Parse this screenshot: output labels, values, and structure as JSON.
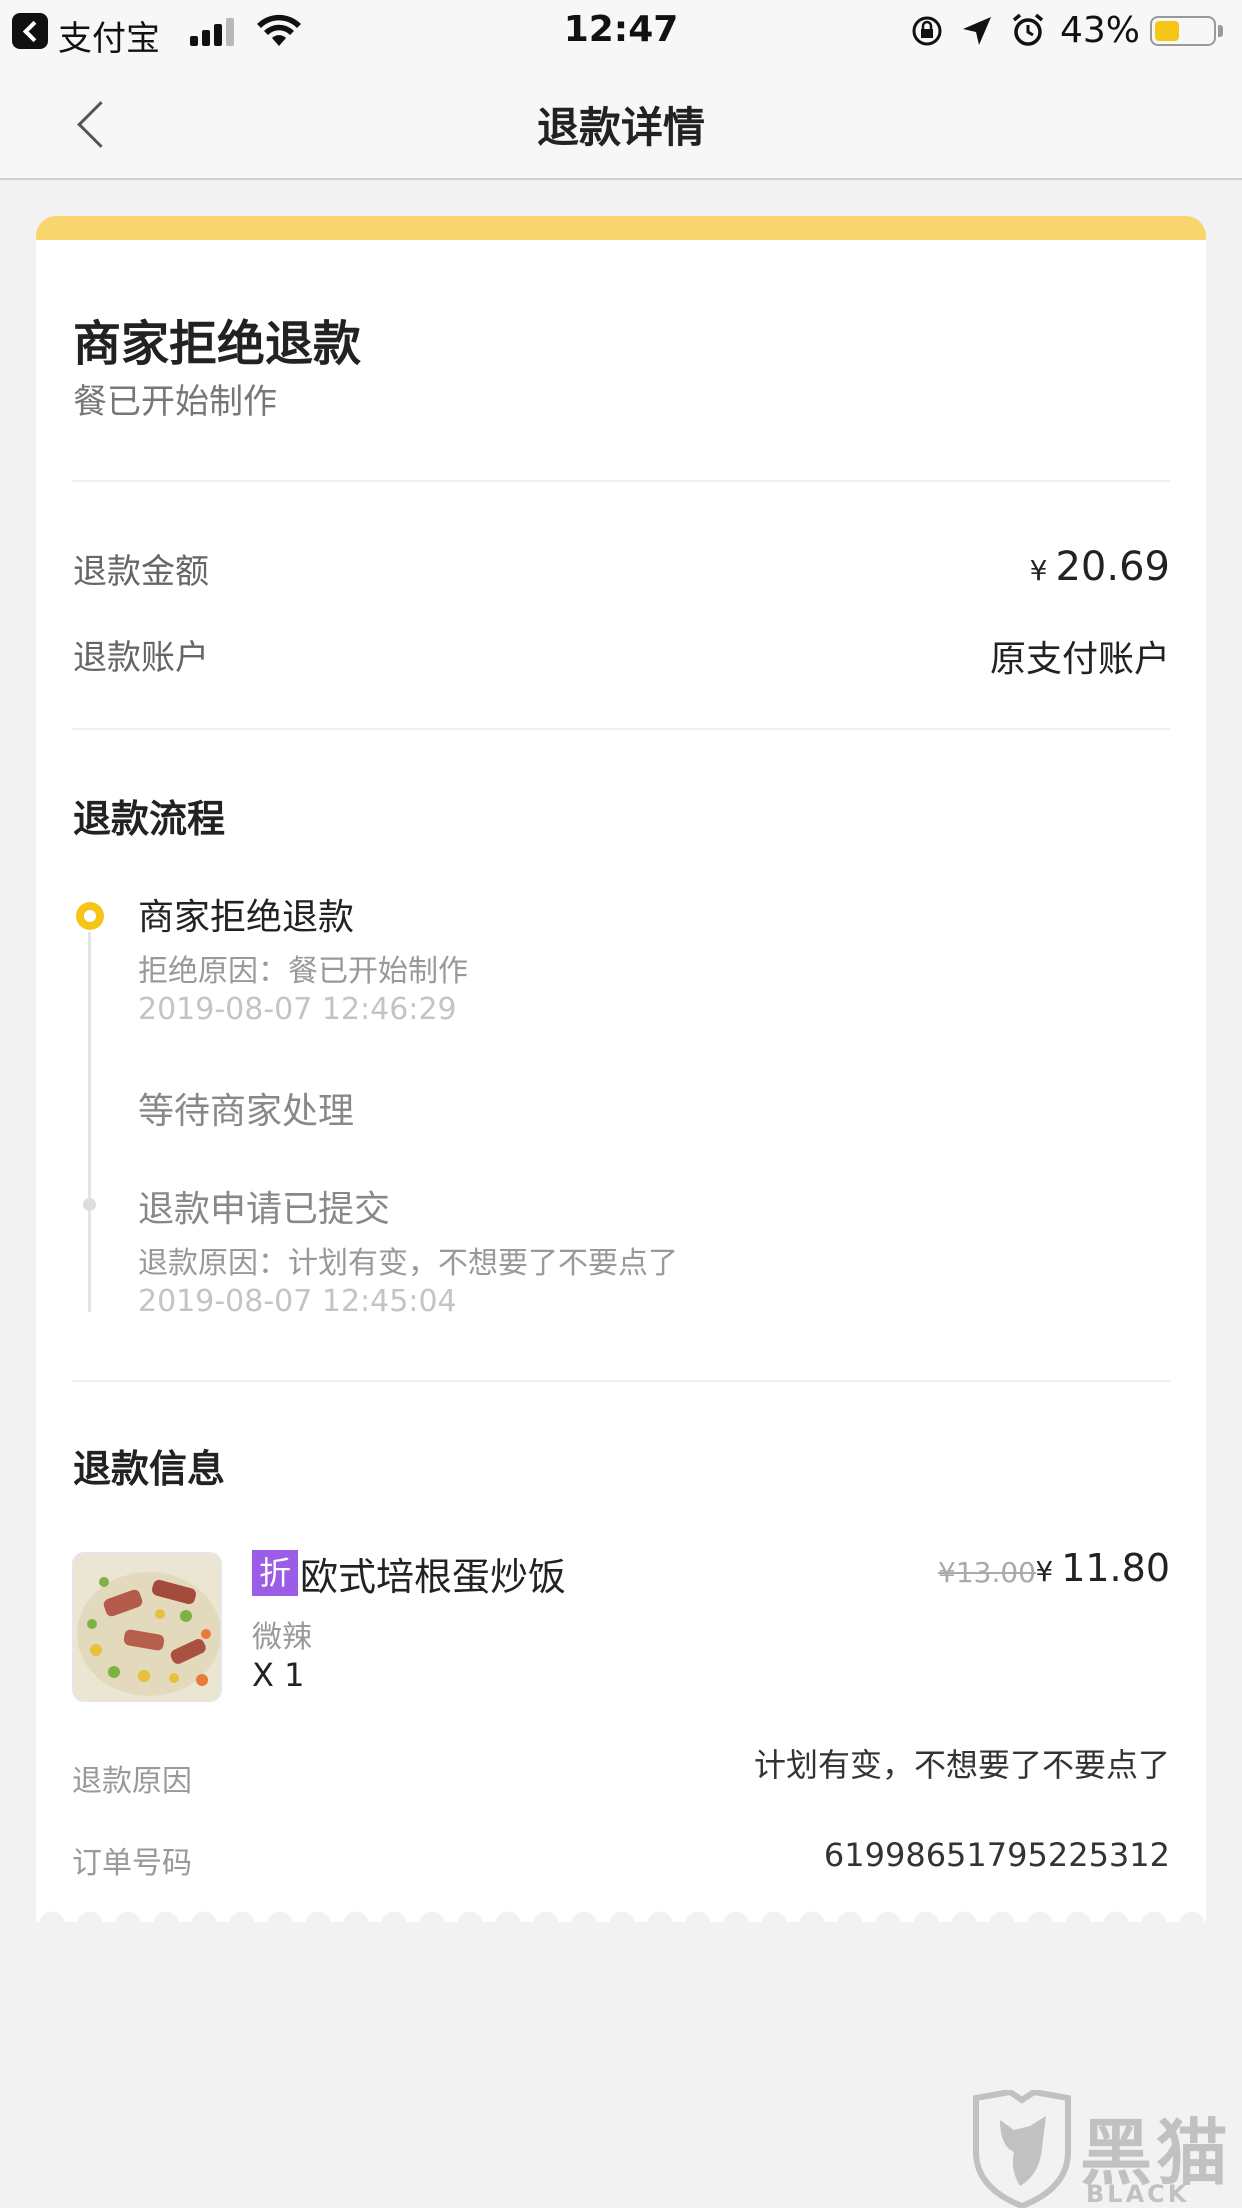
{
  "status_bar": {
    "app_name": "支付宝",
    "time": "12:47",
    "battery_percent": "43%",
    "battery_level": 0.43,
    "signal_bars": 3
  },
  "nav": {
    "title": "退款详情"
  },
  "refund_status": {
    "title": "商家拒绝退款",
    "subtitle": "餐已开始制作"
  },
  "amount_row": {
    "label": "退款金额",
    "currency": "¥",
    "value": "20.69"
  },
  "account_row": {
    "label": "退款账户",
    "value": "原支付账户"
  },
  "process": {
    "title": "退款流程",
    "steps": [
      {
        "title": "商家拒绝退款",
        "desc": "拒绝原因：餐已开始制作",
        "time": "2019-08-07 12:46:29"
      },
      {
        "title": "等待商家处理"
      },
      {
        "title": "退款申请已提交",
        "desc": "退款原因：计划有变，不想要了不要点了",
        "time": "2019-08-07 12:45:04"
      }
    ]
  },
  "info": {
    "title": "退款信息",
    "item": {
      "tag": "折",
      "name": "欧式培根蛋炒饭",
      "spec": "微辣",
      "qty": "X 1",
      "original_price": "¥13.00",
      "currency": "¥",
      "price": "11.80"
    },
    "reason_label": "退款原因",
    "reason_value": "计划有变，不想要了不要点了",
    "order_label": "订单号码",
    "order_value": "61998651795225312"
  },
  "watermark": {
    "text_cn": "黑猫",
    "text_en": "BLACK CAT"
  },
  "colors": {
    "accent_yellow": "#f8d56e",
    "dot_yellow": "#f5c518",
    "discount_purple": "#9b5de5"
  }
}
